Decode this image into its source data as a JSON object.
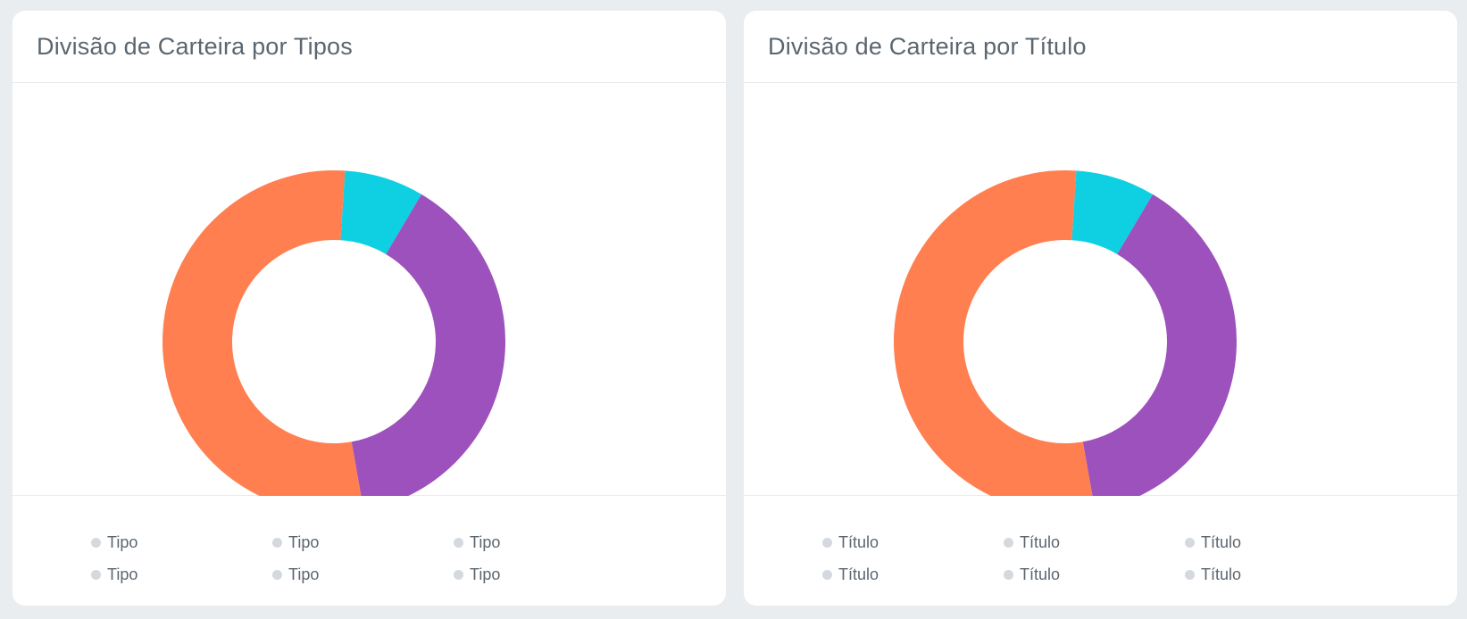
{
  "colors": {
    "orange": "#ff7f50",
    "cyan": "#0ed0e2",
    "purple": "#9d51bc",
    "legend_dot": "#d3d9de",
    "title_text": "#5b6670"
  },
  "chart_data": [
    {
      "type": "pie",
      "title": "Divisão de Carteira por Tipos",
      "donut": true,
      "slices": [
        {
          "value": 7.5,
          "color": "#0ed0e2"
        },
        {
          "value": 38.7,
          "color": "#9d51bc"
        },
        {
          "value": 53.8,
          "color": "#ff7f50"
        }
      ],
      "legend": [
        "Tipo",
        "Tipo",
        "Tipo",
        "Tipo",
        "Tipo",
        "Tipo"
      ],
      "legend_placement": "bottom"
    },
    {
      "type": "pie",
      "title": "Divisão de Carteira por Título",
      "donut": true,
      "slices": [
        {
          "value": 7.5,
          "color": "#0ed0e2"
        },
        {
          "value": 38.7,
          "color": "#9d51bc"
        },
        {
          "value": 53.8,
          "color": "#ff7f50"
        }
      ],
      "legend": [
        "Título",
        "Título",
        "Título",
        "Título",
        "Título",
        "Título"
      ],
      "legend_placement": "bottom"
    }
  ]
}
